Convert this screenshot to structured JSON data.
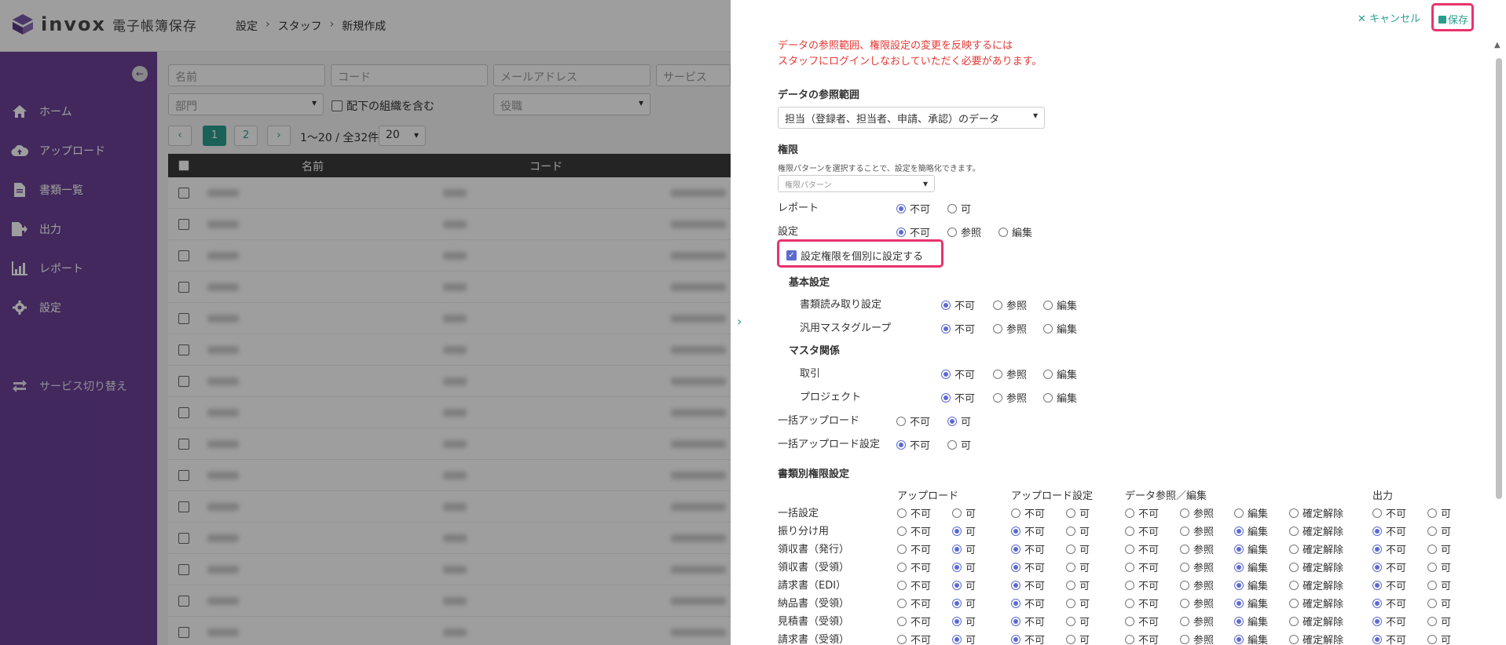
{
  "app": {
    "name": "invox",
    "subtitle": "電子帳簿保存"
  },
  "breadcrumb": [
    "設定",
    "スタッフ",
    "新規作成"
  ],
  "sidebar": {
    "items": [
      {
        "label": "ホーム",
        "icon": "home-icon"
      },
      {
        "label": "アップロード",
        "icon": "cloud-upload-icon"
      },
      {
        "label": "書類一覧",
        "icon": "document-icon"
      },
      {
        "label": "出力",
        "icon": "export-icon"
      },
      {
        "label": "レポート",
        "icon": "chart-icon"
      },
      {
        "label": "設定",
        "icon": "gear-icon"
      },
      {
        "label": "サービス切り替え",
        "icon": "switch-icon"
      }
    ]
  },
  "filters": {
    "name_placeholder": "名前",
    "code_placeholder": "コード",
    "email_placeholder": "メールアドレス",
    "service_placeholder": "サービス",
    "dept_placeholder": "部門",
    "include_sub_label": "配下の組織を含む",
    "role_placeholder": "役職"
  },
  "pagination": {
    "pages": [
      "1",
      "2"
    ],
    "range_text": "1〜20 / 全32件",
    "per_page": "20"
  },
  "table": {
    "columns": [
      "名前",
      "コード"
    ]
  },
  "panel": {
    "cancel_label": "キャンセル",
    "save_label": "保存",
    "warning_line1": "データの参照範囲、権限設定の変更を反映するには",
    "warning_line2": "スタッフにログインしなおしていただく必要があります。",
    "scope_title": "データの参照範囲",
    "scope_value": "担当（登録者、担当者、申請、承認）のデータ",
    "perm_title": "権限",
    "perm_help": "権限パターンを選択することで、設定を簡略化できます。",
    "perm_pattern_placeholder": "権限パターン",
    "report_label": "レポート",
    "settings_label": "設定",
    "individual_label": "設定権限を個別に設定する",
    "basic_title": "基本設定",
    "doc_read_label": "書類読み取り設定",
    "master_group_label": "汎用マスタグループ",
    "master_title": "マスタ関係",
    "torihiki_label": "取引",
    "project_label": "プロジェクト",
    "bulk_upload_label": "一括アップロード",
    "bulk_upload_setting_label": "一括アップロード設定",
    "doc_perm_title": "書類別権限設定",
    "col_upload": "アップロード",
    "col_upload_setting": "アップロード設定",
    "col_data": "データ参照／編集",
    "col_output": "出力",
    "opt_no": "不可",
    "opt_yes": "可",
    "opt_view": "参照",
    "opt_edit": "編集",
    "opt_unconfirm": "確定解除",
    "doc_rows": [
      "一括設定",
      "振り分け用",
      "領収書（発行）",
      "領収書（受領）",
      "請求書（EDI）",
      "納品書（受領）",
      "見積書（受領）",
      "請求書（受領）"
    ],
    "accent_color": "#2a9d8f",
    "highlight_color": "#e8336c"
  }
}
